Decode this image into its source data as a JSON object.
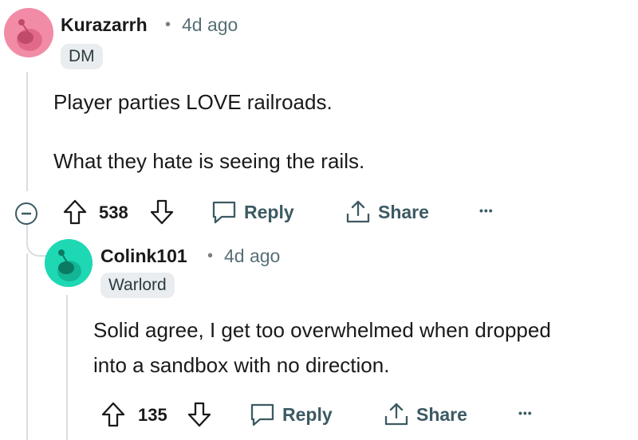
{
  "comments": [
    {
      "username": "Kurazarrh",
      "separator": "•",
      "time": "4d ago",
      "flair": "DM",
      "body": [
        "Player parties LOVE railroads.",
        "What they hate is seeing the rails."
      ],
      "votes": "538",
      "reply_label": "Reply",
      "share_label": "Share",
      "more_label": "•••",
      "avatar_color": "#f28ca6"
    },
    {
      "username": "Colink101",
      "separator": "•",
      "time": "4d ago",
      "flair": "Warlord",
      "body": [
        "Solid agree, I get too overwhelmed when dropped",
        "into a sandbox with no direction."
      ],
      "votes": "135",
      "reply_label": "Reply",
      "share_label": "Share",
      "more_label": "•••",
      "avatar_color": "#1ed8b4"
    }
  ],
  "colors": {
    "text": "#1a1a1b",
    "muted": "#576f76",
    "flair_bg": "#eaedef",
    "thread_line": "#d8dde0"
  }
}
